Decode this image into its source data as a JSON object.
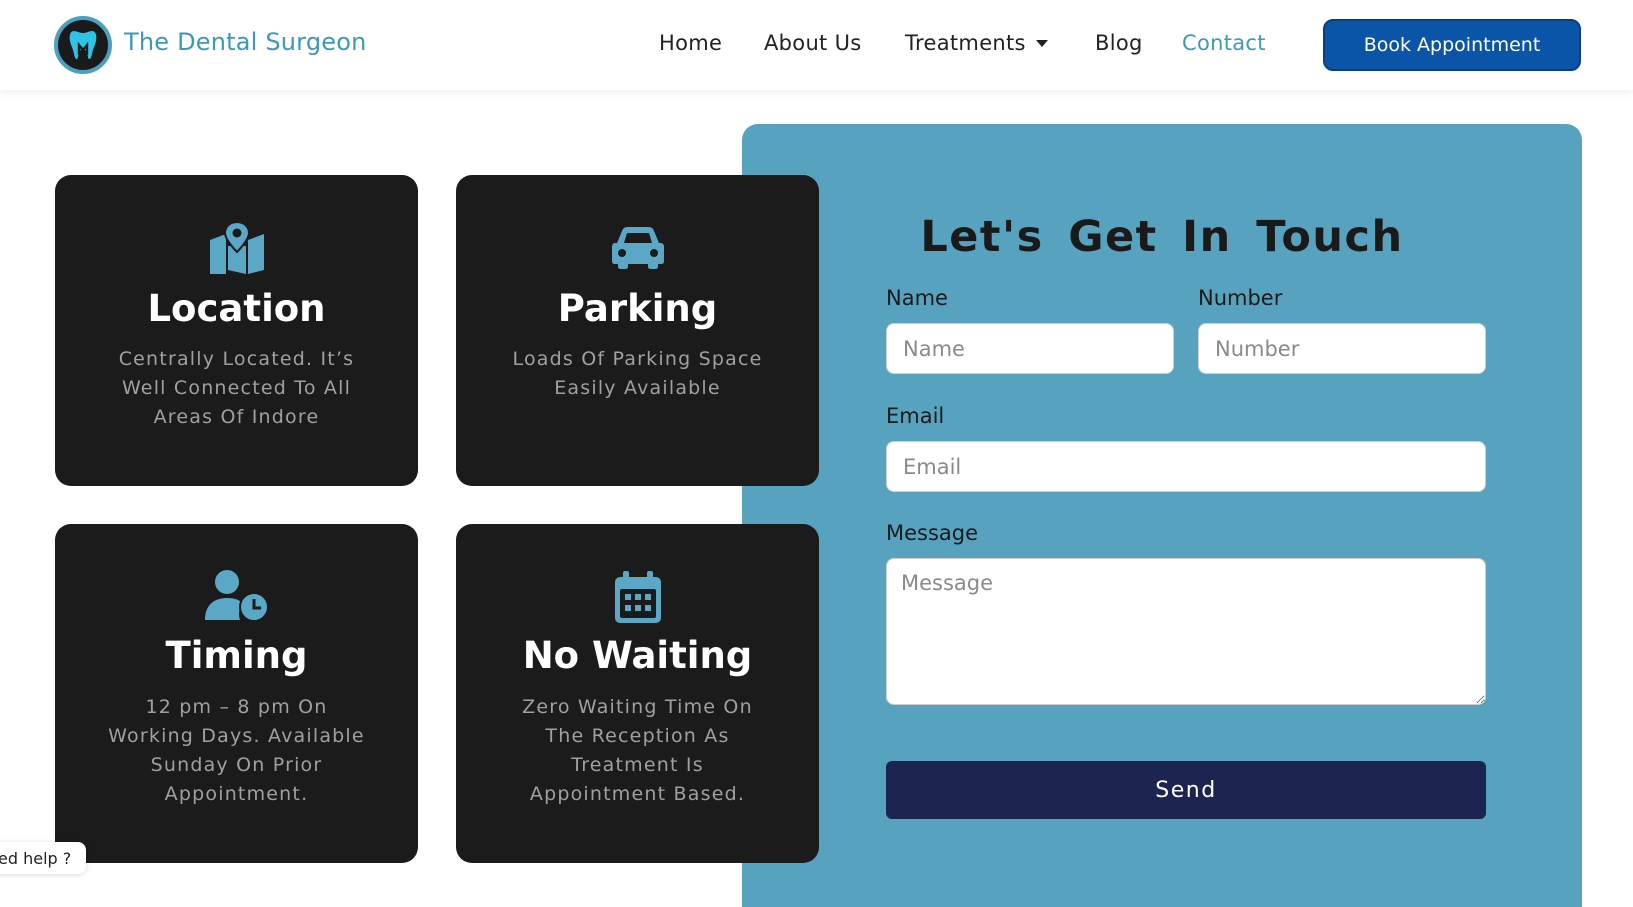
{
  "header": {
    "brand": "The Dental Surgeon",
    "nav": {
      "home": "Home",
      "about": "About Us",
      "treatments": "Treatments",
      "blog": "Blog",
      "contact": "Contact"
    },
    "book_label": "Book Appointment"
  },
  "cards": [
    {
      "icon": "map-pin-icon",
      "title": "Location",
      "desc": "Centrally Located. It’s Well Connected To All Areas Of Indore"
    },
    {
      "icon": "car-icon",
      "title": "Parking",
      "desc": "Loads Of Parking Space Easily Available"
    },
    {
      "icon": "user-clock-icon",
      "title": "Timing",
      "desc": "12 pm – 8 pm On Working Days. Available Sunday On Prior Appointment."
    },
    {
      "icon": "calendar-icon",
      "title": "No Waiting",
      "desc": "Zero Waiting Time On The Reception As Treatment Is Appointment Based."
    }
  ],
  "form": {
    "title": "Let's Get In Touch",
    "name_label": "Name",
    "name_placeholder": "Name",
    "number_label": "Number",
    "number_placeholder": "Number",
    "email_label": "Email",
    "email_placeholder": "Email",
    "message_label": "Message",
    "message_placeholder": "Message",
    "send_label": "Send"
  },
  "help": "ed help ?",
  "colors": {
    "accent": "#57a3bf",
    "brand": "#3a9ab8",
    "button": "#0b55a8",
    "send": "#1c2452",
    "card": "#1b1b1c"
  }
}
